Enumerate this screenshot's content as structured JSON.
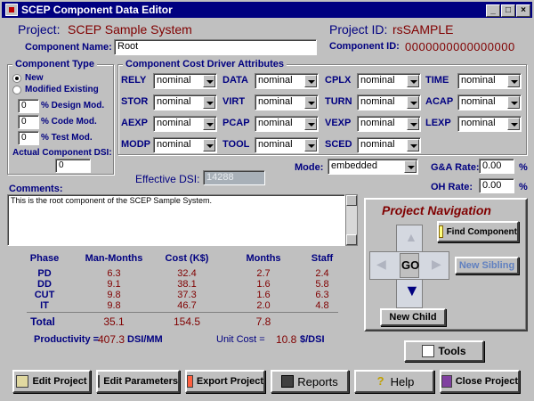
{
  "window": {
    "title": "SCEP Component Data Editor"
  },
  "header": {
    "project_label": "Project:",
    "project_value": "SCEP Sample System",
    "project_id_label": "Project ID:",
    "project_id_value": "rsSAMPLE",
    "component_name_label": "Component Name:",
    "component_name_value": "Root",
    "component_id_label": "Component ID:",
    "component_id_value": "0000000000000000"
  },
  "component_type": {
    "title": "Component Type",
    "new_label": "New",
    "modified_label": "Modified Existing",
    "design_value": "0",
    "design_label": "% Design Mod.",
    "code_value": "0",
    "code_label": "% Code Mod.",
    "test_value": "0",
    "test_label": "% Test Mod.",
    "actual_dsi_label": "Actual Component DSI:",
    "actual_dsi_value": "0"
  },
  "cost_drivers": {
    "title": "Component Cost Driver Attributes",
    "rows": [
      [
        {
          "l": "RELY",
          "v": "nominal"
        },
        {
          "l": "DATA",
          "v": "nominal"
        },
        {
          "l": "CPLX",
          "v": "nominal"
        },
        {
          "l": "TIME",
          "v": "nominal"
        }
      ],
      [
        {
          "l": "STOR",
          "v": "nominal"
        },
        {
          "l": "VIRT",
          "v": "nominal"
        },
        {
          "l": "TURN",
          "v": "nominal"
        },
        {
          "l": "ACAP",
          "v": "nominal"
        }
      ],
      [
        {
          "l": "AEXP",
          "v": "nominal"
        },
        {
          "l": "PCAP",
          "v": "nominal"
        },
        {
          "l": "VEXP",
          "v": "nominal"
        },
        {
          "l": "LEXP",
          "v": "nominal"
        }
      ],
      [
        {
          "l": "MODP",
          "v": "nominal"
        },
        {
          "l": "TOOL",
          "v": "nominal"
        },
        {
          "l": "SCED",
          "v": "nominal"
        }
      ]
    ]
  },
  "mode": {
    "label": "Mode:",
    "value": "embedded"
  },
  "rates": {
    "ga_label": "G&A Rate:",
    "ga_value": "0.00",
    "oh_label": "OH Rate:",
    "oh_value": "0.00",
    "pct": "%"
  },
  "effective_dsi": {
    "label": "Effective DSI:",
    "value": "14288"
  },
  "comments": {
    "label": "Comments:",
    "value": "This is the root component of the SCEP Sample System."
  },
  "table": {
    "headers": [
      "Phase",
      "Man-Months",
      "Cost (K$)",
      "Months",
      "Staff"
    ],
    "rows": [
      [
        "PD",
        "6.3",
        "32.4",
        "2.7",
        "2.4"
      ],
      [
        "DD",
        "9.1",
        "38.1",
        "1.6",
        "5.8"
      ],
      [
        "CUT",
        "9.8",
        "37.3",
        "1.6",
        "6.3"
      ],
      [
        "IT",
        "9.8",
        "46.7",
        "2.0",
        "4.8"
      ]
    ],
    "total_label": "Total",
    "total_mm": "35.1",
    "total_cost": "154.5",
    "total_months": "7.8",
    "productivity_label": "Productivity =",
    "productivity_value": "407.3",
    "productivity_unit": "DSI/MM",
    "unit_cost_label": "Unit Cost =",
    "unit_cost_value": "10.8",
    "unit_cost_unit": "$/DSI"
  },
  "nav": {
    "title": "Project Navigation",
    "find_component": "Find Component",
    "new_sibling": "New Sibling",
    "go": "GO",
    "new_child": "New Child"
  },
  "buttons": {
    "tools": "Tools",
    "edit_project": "Edit Project",
    "edit_parameters": "Edit Parameters",
    "export_project": "Export Project",
    "reports": "Reports",
    "help": "Help",
    "close_project": "Close Project"
  }
}
